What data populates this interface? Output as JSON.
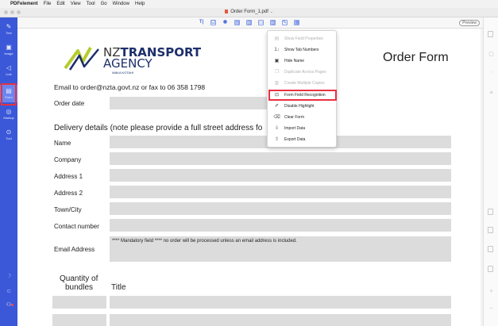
{
  "menubar": {
    "apple": "",
    "app_name": "PDFelement",
    "items": [
      "File",
      "Edit",
      "View",
      "Tool",
      "Go",
      "Window",
      "Help"
    ]
  },
  "window": {
    "title": "Order Form_1.pdf"
  },
  "toolbar": {
    "tools": [
      {
        "icon": "text-field-icon",
        "glyph": "T|"
      },
      {
        "icon": "checkbox-icon",
        "glyph": "☑"
      },
      {
        "icon": "radio-button-icon",
        "glyph": "◉"
      },
      {
        "icon": "combo-box-icon",
        "glyph": "▤"
      },
      {
        "icon": "list-box-icon",
        "glyph": "▥"
      },
      {
        "icon": "button-icon",
        "glyph": "▭"
      },
      {
        "icon": "image-field-icon",
        "glyph": "▧"
      },
      {
        "icon": "signature-field-icon",
        "glyph": "✎"
      },
      {
        "icon": "more-form-icon",
        "glyph": "▦"
      }
    ],
    "preview_label": "Preview"
  },
  "sidebar": {
    "items": [
      {
        "name": "text",
        "label": "Text",
        "glyph": "✎"
      },
      {
        "name": "image",
        "label": "Image",
        "glyph": "▣"
      },
      {
        "name": "link",
        "label": "Link",
        "glyph": "◁"
      },
      {
        "name": "form",
        "label": "Form",
        "glyph": "▤"
      },
      {
        "name": "markup",
        "label": "Markup",
        "glyph": "◎"
      },
      {
        "name": "tool",
        "label": "Tool",
        "glyph": "⊙"
      }
    ],
    "active": "Form"
  },
  "document": {
    "logo_line1_bold": "TRANSPORT",
    "logo_line1_prefix": "NZ",
    "logo_line2": "AGENCY",
    "logo_line3": "WAKA KOTAHI",
    "heading": "Order Form",
    "email_line": "Email to order@nzta.govt.nz or fax to 06 358 1798",
    "order_date_label": "Order date",
    "delivery_heading": "Delivery details (note please provide a full street address fo",
    "fields": [
      "Name",
      "Company",
      "Address 1",
      "Address 2",
      "Town/City",
      "Contact number"
    ],
    "email_label": "Email Address",
    "email_notice": "**** Mandatory field **** no order will be processed unless an email address is included.",
    "quantity_label_1": "Quantity of",
    "quantity_label_2": "bundles",
    "title_label": "Title"
  },
  "context_menu": {
    "items": [
      {
        "label": "Show Field Properties",
        "glyph": "▤",
        "disabled": true
      },
      {
        "label": "Show Tab Numbers",
        "glyph": "1↓",
        "disabled": false
      },
      {
        "label": "Hide Name",
        "glyph": "▣",
        "disabled": false
      },
      {
        "label": "Duplicate Across Pages",
        "glyph": "❐",
        "disabled": true
      },
      {
        "label": "Create Multiple Copies",
        "glyph": "▥",
        "disabled": true
      },
      {
        "label": "Form Field Recognition",
        "glyph": "⊡",
        "disabled": false
      },
      {
        "label": "Disable Highlight",
        "glyph": "✐",
        "disabled": false
      },
      {
        "label": "Clear Form",
        "glyph": "⌫",
        "disabled": false
      },
      {
        "label": "Import Data",
        "glyph": "⇩",
        "disabled": false
      },
      {
        "label": "Export Data",
        "glyph": "⇧",
        "disabled": false
      }
    ],
    "highlighted": "Form Field Recognition"
  },
  "colors": {
    "sidebar": "#3a58d8",
    "highlight_outline": "#e8313f",
    "field_fill": "#dcdcdc"
  }
}
